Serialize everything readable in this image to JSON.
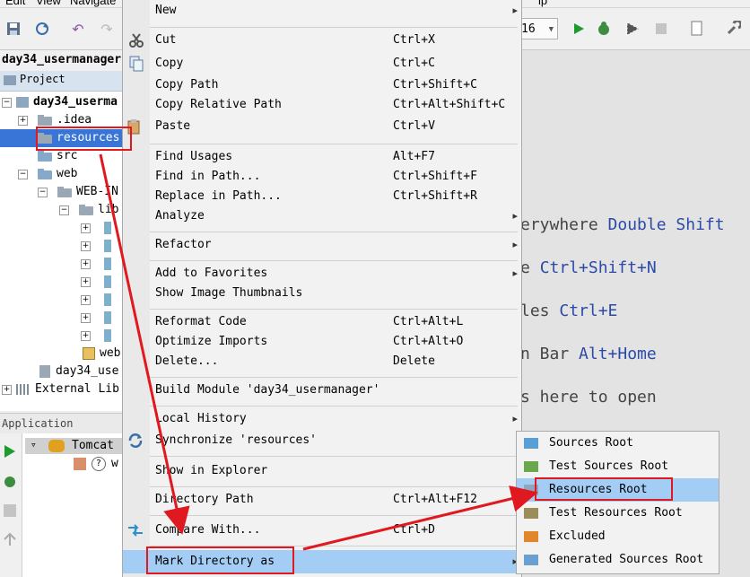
{
  "menubar": {
    "items": [
      "Edit",
      "View",
      "Navigate",
      "ip"
    ]
  },
  "toolbar": {
    "run_config_value": "16"
  },
  "project": {
    "breadcrumb": "day34_usermanager",
    "tab_label": "Project",
    "tree": [
      {
        "label": "day34_userma",
        "kind": "module"
      },
      {
        "label": ".idea",
        "kind": "folder"
      },
      {
        "label": "resources",
        "kind": "folder",
        "selected": true
      },
      {
        "label": "src",
        "kind": "folder-blue"
      },
      {
        "label": "web",
        "kind": "folder-blue"
      },
      {
        "label": "WEB-IN",
        "kind": "folder"
      },
      {
        "label": "lib",
        "kind": "folder"
      },
      {
        "label": "web",
        "kind": "file"
      },
      {
        "label": "day34_use",
        "kind": "iml"
      },
      {
        "label": "External Lib",
        "kind": "libs"
      }
    ]
  },
  "app_servers": {
    "header": "Application Servers",
    "server": "Tomcat",
    "artifact": "w"
  },
  "editor_hints": [
    {
      "prefix": "erywhere ",
      "key": "Double Shift"
    },
    {
      "prefix": "e ",
      "key": "Ctrl+Shift+N"
    },
    {
      "prefix": "les ",
      "key": "Ctrl+E"
    },
    {
      "prefix": "n Bar ",
      "key": "Alt+Home"
    },
    {
      "prefix": "s here to open",
      "key": ""
    }
  ],
  "context_menu": {
    "items": [
      {
        "label": "New",
        "shortcut": "",
        "submenu": true
      },
      {
        "label": "Cut",
        "shortcut": "Ctrl+X",
        "icon": "scissors-icon"
      },
      {
        "label": "Copy",
        "shortcut": "Ctrl+C",
        "icon": "copy-icon"
      },
      {
        "label": "Copy Path",
        "shortcut": "Ctrl+Shift+C"
      },
      {
        "label": "Copy Relative Path",
        "shortcut": "Ctrl+Alt+Shift+C"
      },
      {
        "label": "Paste",
        "shortcut": "Ctrl+V",
        "icon": "paste-icon"
      },
      {
        "label": "Find Usages",
        "shortcut": "Alt+F7"
      },
      {
        "label": "Find in Path...",
        "shortcut": "Ctrl+Shift+F"
      },
      {
        "label": "Replace in Path...",
        "shortcut": "Ctrl+Shift+R"
      },
      {
        "label": "Analyze",
        "shortcut": "",
        "submenu": true
      },
      {
        "label": "Refactor",
        "shortcut": "",
        "submenu": true
      },
      {
        "label": "Add to Favorites",
        "shortcut": "",
        "submenu": true
      },
      {
        "label": "Show Image Thumbnails",
        "shortcut": ""
      },
      {
        "label": "Reformat Code",
        "shortcut": "Ctrl+Alt+L"
      },
      {
        "label": "Optimize Imports",
        "shortcut": "Ctrl+Alt+O"
      },
      {
        "label": "Delete...",
        "shortcut": "Delete"
      },
      {
        "label": "Build Module 'day34_usermanager'",
        "shortcut": ""
      },
      {
        "label": "Local History",
        "shortcut": "",
        "submenu": true
      },
      {
        "label": "Synchronize 'resources'",
        "shortcut": "",
        "icon": "sync-icon"
      },
      {
        "label": "Show in Explorer",
        "shortcut": ""
      },
      {
        "label": "Directory Path",
        "shortcut": "Ctrl+Alt+F12"
      },
      {
        "label": "Compare With...",
        "shortcut": "Ctrl+D",
        "icon": "compare-icon"
      },
      {
        "label": "Mark Directory as",
        "shortcut": "",
        "submenu": true
      }
    ]
  },
  "mark_directory_submenu": {
    "items": [
      {
        "label": "Sources Root",
        "color": "#5a9fd4"
      },
      {
        "label": "Test Sources Root",
        "color": "#6aa84f"
      },
      {
        "label": "Resources Root",
        "color": "#8fa6bf"
      },
      {
        "label": "Test Resources Root",
        "color": "#9a8d5a"
      },
      {
        "label": "Excluded",
        "color": "#e2862a"
      },
      {
        "label": "Generated Sources Root",
        "color": "#6b9ed1"
      }
    ]
  },
  "colors": {
    "selection": "#3875d7",
    "menu_highlight": "#a4cdf6",
    "annotation_red": "#e0181f",
    "shortcut_key_blue": "#2b4aa8"
  }
}
